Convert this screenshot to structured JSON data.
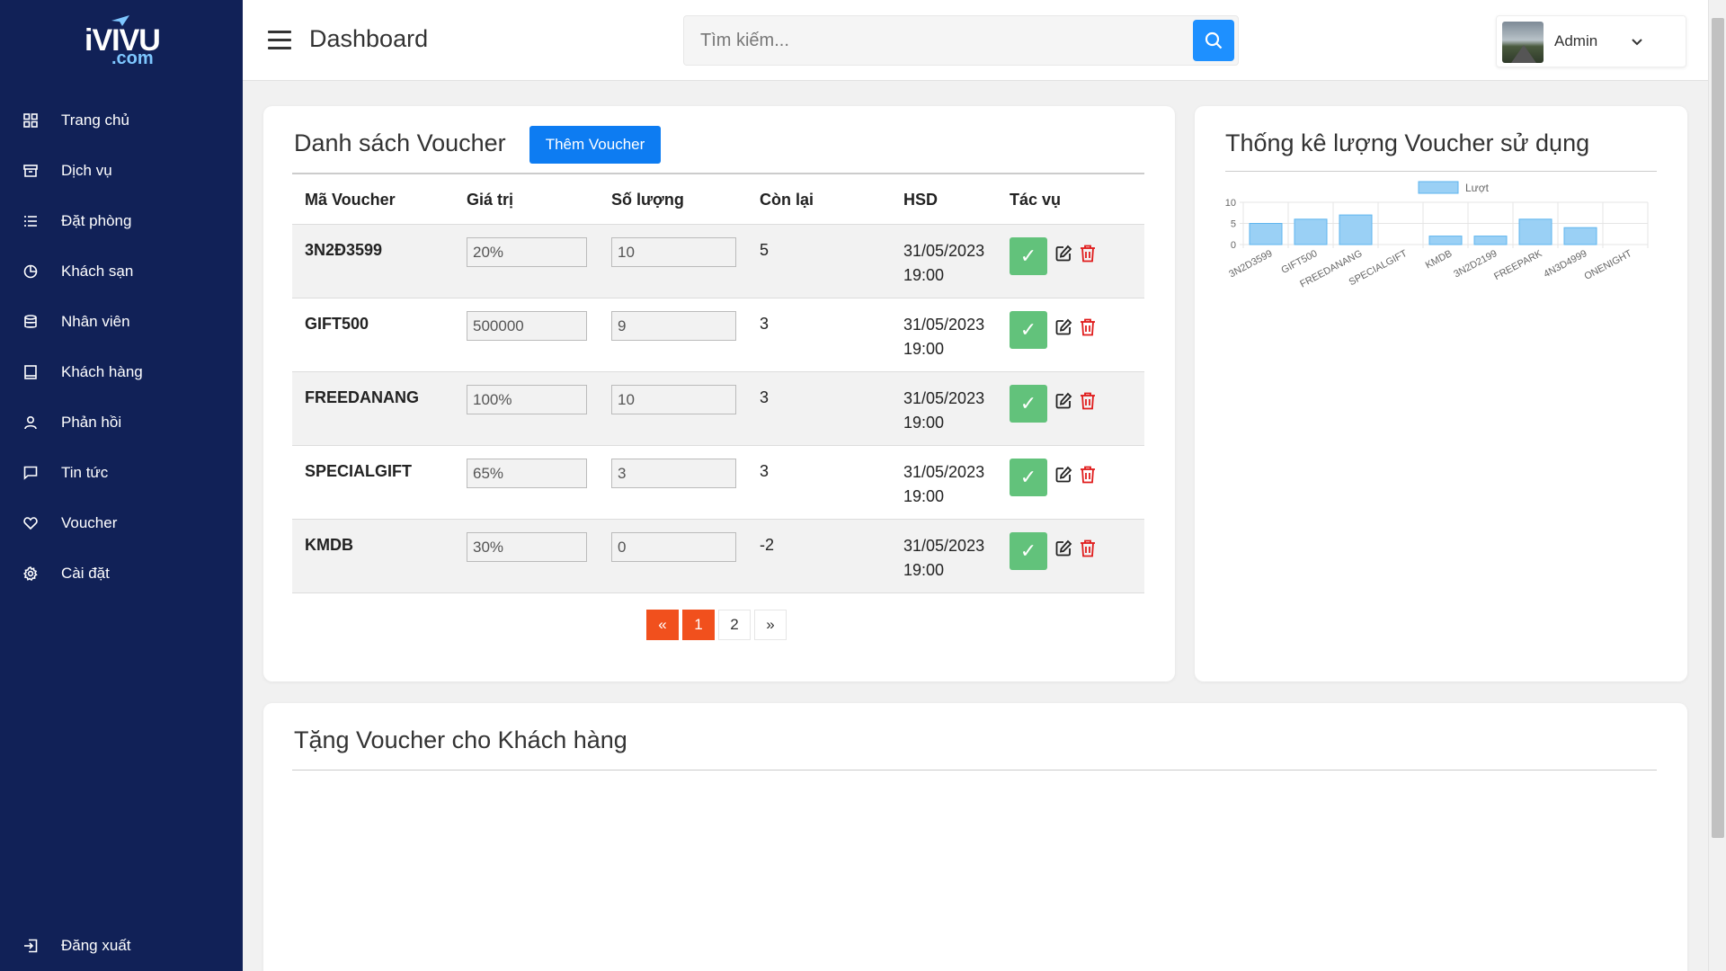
{
  "brand": {
    "logo_text": "iVIVU",
    "logo_sub": ".com"
  },
  "sidebar": {
    "items": [
      {
        "label": "Trang chủ",
        "icon": "grid-icon"
      },
      {
        "label": "Dịch vụ",
        "icon": "archive-icon"
      },
      {
        "label": "Đặt phòng",
        "icon": "list-icon"
      },
      {
        "label": "Khách sạn",
        "icon": "pie-chart-icon"
      },
      {
        "label": "Nhân viên",
        "icon": "database-icon"
      },
      {
        "label": "Khách hàng",
        "icon": "book-icon"
      },
      {
        "label": "Phản hồi",
        "icon": "user-icon"
      },
      {
        "label": "Tin tức",
        "icon": "chat-icon"
      },
      {
        "label": "Voucher",
        "icon": "heart-icon"
      },
      {
        "label": "Cài đặt",
        "icon": "settings-icon"
      }
    ],
    "logout_label": "Đăng xuất"
  },
  "header": {
    "title": "Dashboard",
    "search_placeholder": "Tìm kiếm...",
    "user_name": "Admin"
  },
  "voucher_list": {
    "title": "Danh sách Voucher",
    "add_button": "Thêm Voucher",
    "columns": [
      "Mã Voucher",
      "Giá trị",
      "Số lượng",
      "Còn lại",
      "HSD",
      "Tác vụ"
    ],
    "rows": [
      {
        "code": "3N2Đ3599",
        "value": "20%",
        "quantity": "10",
        "remaining": "5",
        "hsd_date": "31/05/2023",
        "hsd_time": "19:00"
      },
      {
        "code": "GIFT500",
        "value": "500000",
        "quantity": "9",
        "remaining": "3",
        "hsd_date": "31/05/2023",
        "hsd_time": "19:00"
      },
      {
        "code": "FREEDANANG",
        "value": "100%",
        "quantity": "10",
        "remaining": "3",
        "hsd_date": "31/05/2023",
        "hsd_time": "19:00"
      },
      {
        "code": "SPECIALGIFT",
        "value": "65%",
        "quantity": "3",
        "remaining": "3",
        "hsd_date": "31/05/2023",
        "hsd_time": "19:00"
      },
      {
        "code": "KMDB",
        "value": "30%",
        "quantity": "0",
        "remaining": "-2",
        "hsd_date": "31/05/2023",
        "hsd_time": "19:00"
      }
    ],
    "pagination": {
      "prev": "«",
      "pages": [
        "1",
        "2"
      ],
      "current": "1",
      "next": "»"
    }
  },
  "stats": {
    "title": "Thống kê lượng Voucher sử dụng"
  },
  "chart_data": {
    "type": "bar",
    "categories": [
      "3N2D3599",
      "GIFT500",
      "FREEDANANG",
      "SPECIALGIFT",
      "KMDB",
      "3N2D2199",
      "FREEPARK",
      "4N3D4999",
      "ONENIGHT"
    ],
    "series": [
      {
        "name": "Lượt",
        "values": [
          5,
          6,
          7,
          0,
          2,
          2,
          6,
          4,
          0
        ]
      }
    ],
    "ylim": [
      0,
      10
    ],
    "yticks": [
      0,
      5,
      10
    ],
    "legend": "top",
    "grid": true,
    "color": "#9ad0f5",
    "border_color": "#5eb5ef"
  },
  "gift": {
    "title": "Tặng Voucher cho Khách hàng"
  },
  "colors": {
    "sidebar": "#112157",
    "primary": "#0d7cf2",
    "pager_active": "#f1501d",
    "ok": "#62c27b",
    "delete": "#e01b1b"
  }
}
